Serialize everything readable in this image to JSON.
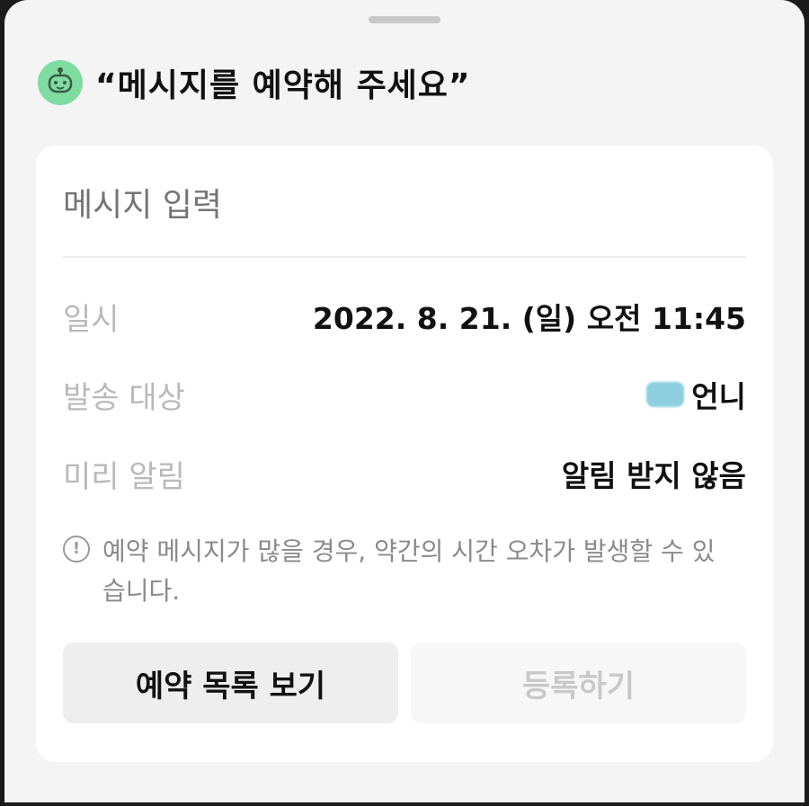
{
  "title": "“메시지를 예약해 주세요”",
  "message_input": {
    "placeholder": "메시지 입력"
  },
  "rows": {
    "datetime": {
      "label": "일시",
      "value": "2022. 8. 21. (일) 오전 11:45"
    },
    "recipient": {
      "label": "발송 대상",
      "value": "언니"
    },
    "reminder": {
      "label": "미리 알림",
      "value": "알림 받지 않음"
    }
  },
  "notice": {
    "icon": "info-circle-icon",
    "text": "예약 메시지가 많을 경우, 약간의 시간 오차가 발생할 수 있습니다."
  },
  "buttons": {
    "list": "예약 목록 보기",
    "register": "등록하기"
  },
  "colors": {
    "accent_icon": "#7fdca0",
    "disabled_text": "#c8c8c8"
  }
}
